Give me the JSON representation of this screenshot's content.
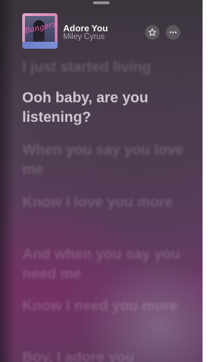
{
  "now_playing": {
    "title": "Adore You",
    "artist": "Miley Cyrus"
  },
  "artwork": {
    "script_text": "Bangerz"
  },
  "actions": {
    "favorite_icon": "star-icon",
    "more_icon": "ellipsis-icon"
  },
  "lyrics": {
    "lines": [
      "I just started living",
      "Ooh baby, are you listening?",
      "When you say you love me",
      "Know I love you more",
      "And when you say you need me",
      "Know I need you more",
      "Boy, I adore you"
    ],
    "active_index": 1
  },
  "colors": {
    "background_top": "#3b343c",
    "background_bottom": "#6a3a66",
    "active_lyric": "#f4ecf4"
  }
}
